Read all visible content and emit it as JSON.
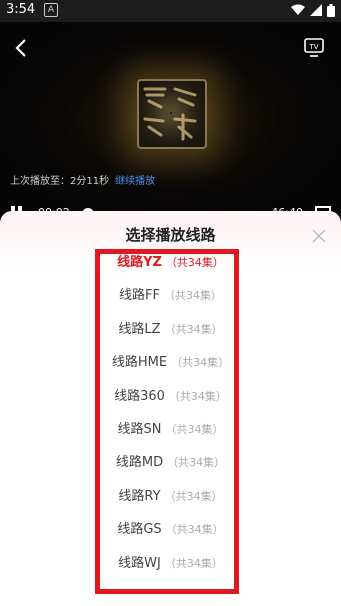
{
  "status_bar": {
    "time": "3:54",
    "app_badge": "A"
  },
  "player": {
    "resume_label": "上次播放至：2分11秒",
    "resume_action": "继续播放",
    "current_time": "00:02",
    "total_time": "46:40"
  },
  "sheet": {
    "title": "选择播放线路",
    "routes": [
      {
        "name": "线路YZ",
        "count": "（共34集）",
        "active": true
      },
      {
        "name": "线路FF",
        "count": "（共34集）"
      },
      {
        "name": "线路LZ",
        "count": "（共34集）"
      },
      {
        "name": "线路HME",
        "count": "（共34集）"
      },
      {
        "name": "线路360",
        "count": "（共34集）"
      },
      {
        "name": "线路SN",
        "count": "（共34集）"
      },
      {
        "name": "线路MD",
        "count": "（共34集）"
      },
      {
        "name": "线路RY",
        "count": "（共34集）"
      },
      {
        "name": "线路GS",
        "count": "（共34集）"
      },
      {
        "name": "线路WJ",
        "count": "（共34集）"
      }
    ]
  },
  "colors": {
    "accent": "#e0191f",
    "link": "#4a8df0",
    "highlight_box": "#e0181f"
  }
}
